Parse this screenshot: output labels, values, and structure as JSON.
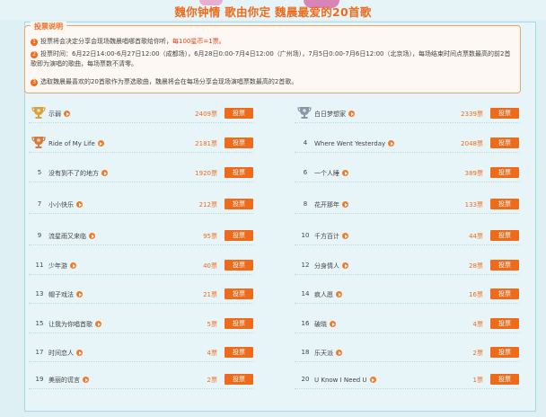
{
  "banner": {
    "title": "魏你钟情 歌由你定 魏晨最爱的20首歌"
  },
  "rules": {
    "title": "投票说明",
    "items": [
      {
        "num": "1",
        "text": "投票将会决定分享会现场魏晨唱哪首歌给你听，",
        "highlight": "每100星币=1票。"
      },
      {
        "num": "2",
        "text": "投票时间：6月22日14:00-6月27日12:00（成都场），6月28日0:00-7月4日12:00（广州场），7月5日0:00-7月6日12:00（北京场），每场结束时间点票数最高的前2首歌即为演唱的歌曲，每场票数不清零。",
        "highlight": ""
      },
      {
        "num": "3",
        "text": "选取魏晨最喜欢的20首歌作为票选歌曲，魏晨将会在每场分享会现场演唱票数最高的2首歌。",
        "highlight": ""
      }
    ]
  },
  "vote_label": "投票",
  "songs": [
    {
      "rank": "1",
      "name": "示弱",
      "votes": "2409票",
      "trophy": "gold"
    },
    {
      "rank": "2",
      "name": "白日梦想家",
      "votes": "2339票",
      "trophy": "silver"
    },
    {
      "rank": "3",
      "name": "Ride of My Life",
      "votes": "2181票",
      "trophy": "bronze"
    },
    {
      "rank": "4",
      "name": "Where Went Yesterday",
      "votes": "2048票",
      "trophy": ""
    },
    {
      "rank": "5",
      "name": "没有到不了的地方",
      "votes": "1920票",
      "trophy": ""
    },
    {
      "rank": "6",
      "name": "一个人睡",
      "votes": "389票",
      "trophy": ""
    },
    {
      "rank": "7",
      "name": "小小快乐",
      "votes": "212票",
      "trophy": ""
    },
    {
      "rank": "8",
      "name": "花开那年",
      "votes": "133票",
      "trophy": ""
    },
    {
      "rank": "9",
      "name": "流星雨又来临",
      "votes": "95票",
      "trophy": ""
    },
    {
      "rank": "10",
      "name": "千方百计",
      "votes": "44票",
      "trophy": ""
    },
    {
      "rank": "11",
      "name": "少年游",
      "votes": "40票",
      "trophy": ""
    },
    {
      "rank": "12",
      "name": "分身情人",
      "votes": "28票",
      "trophy": ""
    },
    {
      "rank": "13",
      "name": "帽子戏法",
      "votes": "21票",
      "trophy": ""
    },
    {
      "rank": "14",
      "name": "疯人愿",
      "votes": "16票",
      "trophy": ""
    },
    {
      "rank": "15",
      "name": "让我为你唱首歌",
      "votes": "5票",
      "trophy": ""
    },
    {
      "rank": "16",
      "name": "破晓",
      "votes": "4票",
      "trophy": ""
    },
    {
      "rank": "17",
      "name": "时间恋人",
      "votes": "4票",
      "trophy": ""
    },
    {
      "rank": "18",
      "name": "乐天派",
      "votes": "2票",
      "trophy": ""
    },
    {
      "rank": "19",
      "name": "美丽的谎言",
      "votes": "2票",
      "trophy": ""
    },
    {
      "rank": "20",
      "name": "U Know I Need U",
      "votes": "1票",
      "trophy": ""
    }
  ],
  "colors": {
    "accent": "#ef6b1c",
    "gold": "#d9a23a",
    "silver": "#8c96a6",
    "bronze": "#d47d3a"
  }
}
